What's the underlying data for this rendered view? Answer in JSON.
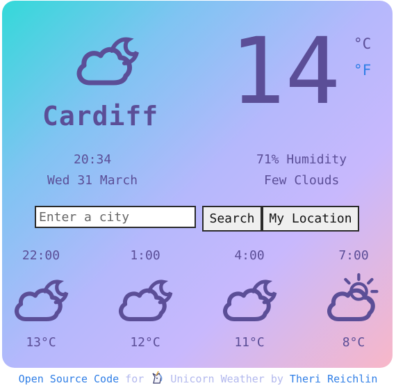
{
  "current": {
    "city": "Cardiff",
    "temperature": "14",
    "unit_c": "°C",
    "unit_f": "°F",
    "time": "20:34",
    "date": "Wed 31 March",
    "humidity": "71% Humidity",
    "description": "Few Clouds",
    "icon": "night-cloud-icon"
  },
  "search": {
    "placeholder": "Enter a city",
    "search_label": "Search",
    "location_label": "My Location"
  },
  "forecast": [
    {
      "time": "22:00",
      "temp": "13°C",
      "icon": "night-cloud-icon"
    },
    {
      "time": "1:00",
      "temp": "12°C",
      "icon": "night-cloud-icon"
    },
    {
      "time": "4:00",
      "temp": "11°C",
      "icon": "night-cloud-icon"
    },
    {
      "time": "7:00",
      "temp": "8°C",
      "icon": "sun-cloud-icon"
    }
  ],
  "footer": {
    "open_source": "Open Source Code",
    "for": "for",
    "app_name": "Unicorn Weather",
    "by": "by",
    "author": "Theri Reichlin"
  },
  "colors": {
    "primary": "#5b4e97",
    "link": "#2f7ee6",
    "muted_link": "#b2b8ee",
    "gradient": [
      "#33d9d9",
      "#b5b8fc",
      "#f8b7c8"
    ]
  }
}
